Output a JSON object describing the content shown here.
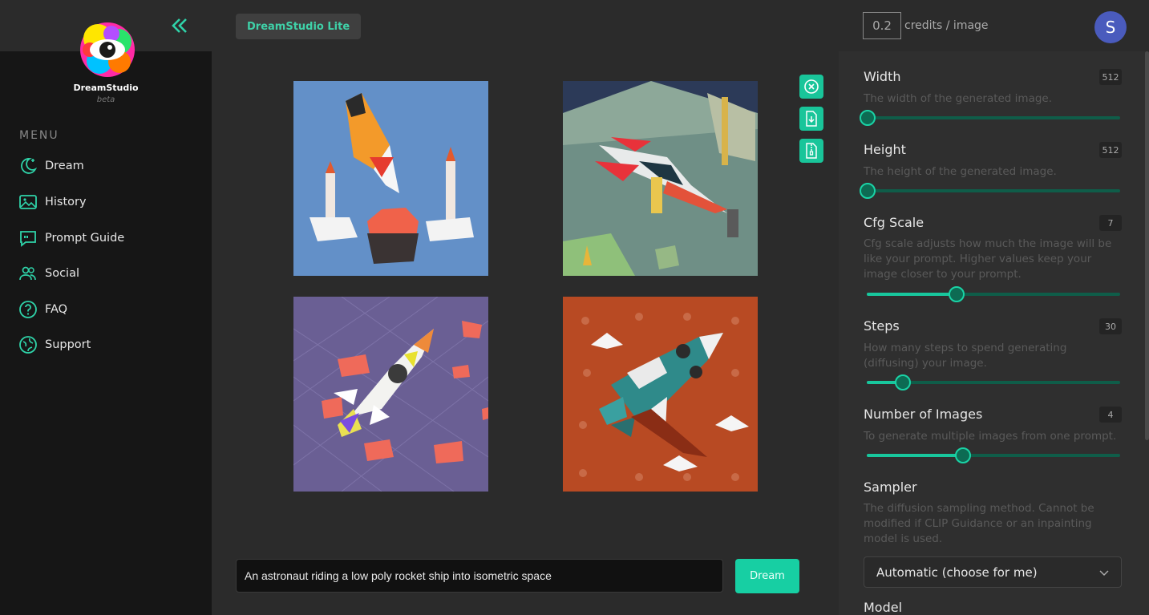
{
  "app": {
    "name": "DreamStudio",
    "badge": "beta",
    "mode_label": "DreamStudio Lite"
  },
  "sidebar": {
    "menu_label": "MENU",
    "items": [
      {
        "label": "Dream",
        "icon": "moon-sparkle-icon"
      },
      {
        "label": "History",
        "icon": "image-gallery-icon"
      },
      {
        "label": "Prompt Guide",
        "icon": "quote-bubble-icon"
      },
      {
        "label": "Social",
        "icon": "users-icon"
      },
      {
        "label": "FAQ",
        "icon": "question-circle-icon"
      },
      {
        "label": "Support",
        "icon": "globe-support-icon"
      }
    ]
  },
  "header": {
    "credits_value": "0.2",
    "credits_label": "credits / image",
    "avatar_initial": "S"
  },
  "toolbar": {
    "icons": [
      "close-circle-icon",
      "download-file-icon",
      "zip-file-icon"
    ]
  },
  "prompt": {
    "value": "An astronaut riding a low poly rocket ship into isometric space",
    "button": "Dream"
  },
  "settings": {
    "width": {
      "label": "Width",
      "value": "512",
      "desc": "The width of the generated image.",
      "level": 0.0
    },
    "height": {
      "label": "Height",
      "value": "512",
      "desc": "The height of the generated image.",
      "level": 0.0
    },
    "cfg": {
      "label": "Cfg Scale",
      "value": "7",
      "desc": "Cfg scale adjusts how much the image will be like your prompt. Higher values keep your image closer to your prompt.",
      "level": 0.35
    },
    "steps": {
      "label": "Steps",
      "value": "30",
      "desc": "How many steps to spend generating (diffusing) your image.",
      "level": 0.14
    },
    "count": {
      "label": "Number of Images",
      "value": "4",
      "desc": "To generate multiple images from one prompt.",
      "level": 0.375
    },
    "sampler": {
      "label": "Sampler",
      "desc": "The diffusion sampling method. Cannot be modified if CLIP Guidance or an inpainting model is used.",
      "selected": "Automatic (choose for me)"
    },
    "model": {
      "label": "Model"
    }
  },
  "colors": {
    "accent": "#17cfa3",
    "sidebar_bg": "#161616",
    "panel_bg": "#2f2f2f"
  }
}
